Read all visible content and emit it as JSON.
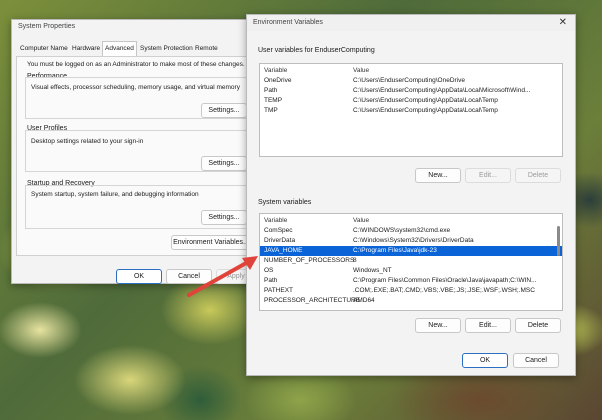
{
  "system_properties": {
    "title": "System Properties",
    "tabs": [
      "Computer Name",
      "Hardware",
      "Advanced",
      "System Protection",
      "Remote"
    ],
    "active_tab": "Advanced",
    "admin_note": "You must be logged on as an Administrator to make most of these changes.",
    "performance": {
      "label": "Performance",
      "desc": "Visual effects, processor scheduling, memory usage, and virtual memory",
      "button": "Settings..."
    },
    "user_profiles": {
      "label": "User Profiles",
      "desc": "Desktop settings related to your sign-in",
      "button": "Settings..."
    },
    "startup": {
      "label": "Startup and Recovery",
      "desc": "System startup, system failure, and debugging information",
      "button": "Settings..."
    },
    "env_button": "Environment Variables...",
    "ok": "OK",
    "cancel": "Cancel",
    "apply": "Apply"
  },
  "env_vars": {
    "title": "Environment Variables",
    "close": "✕",
    "user_section": "User variables for EnduserComputing",
    "columns": [
      "Variable",
      "Value"
    ],
    "user_rows": [
      {
        "var": "OneDrive",
        "val": "C:\\Users\\EnduserComputing\\OneDrive"
      },
      {
        "var": "Path",
        "val": "C:\\Users\\EnduserComputing\\AppData\\Local\\Microsoft\\Wind..."
      },
      {
        "var": "TEMP",
        "val": "C:\\Users\\EnduserComputing\\AppData\\Local\\Temp"
      },
      {
        "var": "TMP",
        "val": "C:\\Users\\EnduserComputing\\AppData\\Local\\Temp"
      }
    ],
    "user_buttons": {
      "new": "New...",
      "edit": "Edit...",
      "delete": "Delete"
    },
    "system_section": "System variables",
    "system_rows": [
      {
        "var": "ComSpec",
        "val": "C:\\WINDOWS\\system32\\cmd.exe"
      },
      {
        "var": "DriverData",
        "val": "C:\\Windows\\System32\\Drivers\\DriverData"
      },
      {
        "var": "JAVA_HOME",
        "val": "C:\\Program Files\\Java\\jdk-23"
      },
      {
        "var": "NUMBER_OF_PROCESSORS",
        "val": "8"
      },
      {
        "var": "OS",
        "val": "Windows_NT"
      },
      {
        "var": "Path",
        "val": "C:\\Program Files\\Common Files\\Oracle\\Java\\javapath;C:\\WIN..."
      },
      {
        "var": "PATHEXT",
        "val": ".COM;.EXE;.BAT;.CMD;.VBS;.VBE;.JS;.JSE;.WSF;.WSH;.MSC"
      },
      {
        "var": "PROCESSOR_ARCHITECTURE",
        "val": "AMD64"
      }
    ],
    "selected_system_row": "JAVA_HOME",
    "system_buttons": {
      "new": "New...",
      "edit": "Edit...",
      "delete": "Delete"
    },
    "ok": "OK",
    "cancel": "Cancel"
  },
  "annotation_color": "#e0433a"
}
